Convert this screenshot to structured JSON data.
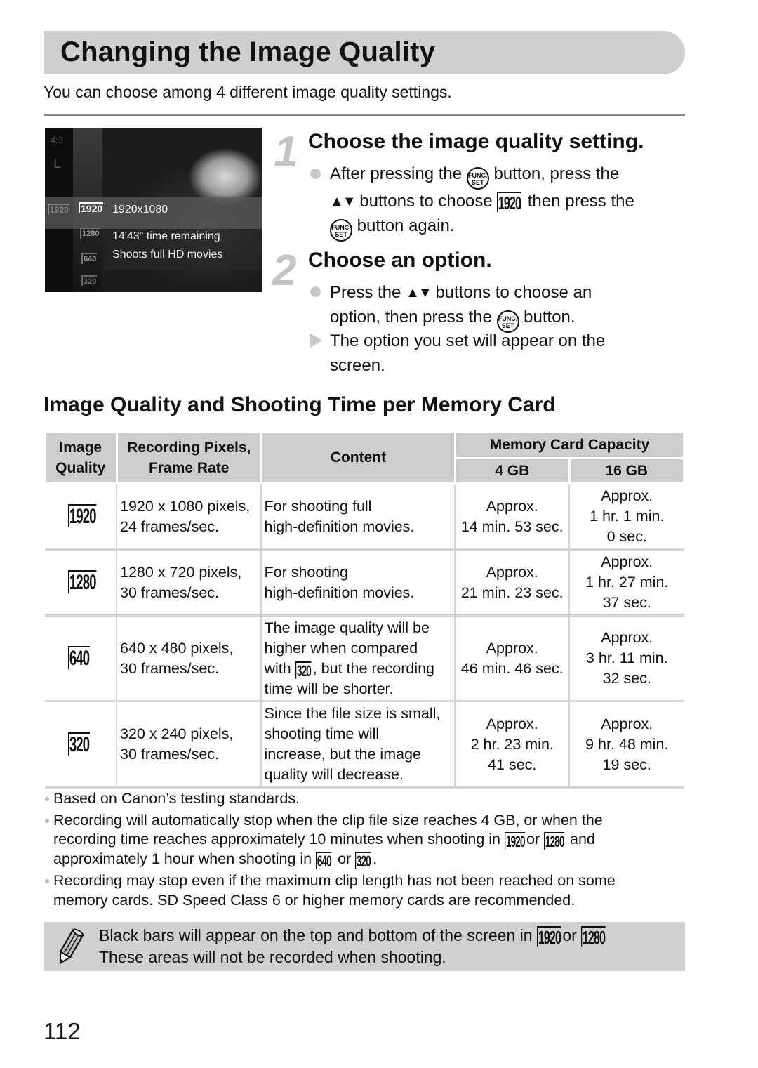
{
  "page": {
    "title": "Changing the Image Quality",
    "intro": "You can choose among 4 different image quality settings.",
    "page_number": "112"
  },
  "camera_screen": {
    "left_column_labels": [
      "4:3",
      "L"
    ],
    "selected_left_icon": "1920",
    "menu_icons": [
      "1920",
      "1280",
      "640",
      "320"
    ],
    "selected_option": "1920x1080",
    "time_remaining": "14'43\" time remaining",
    "description": "Shoots full HD movies"
  },
  "steps": [
    {
      "number": "1",
      "title": "Choose the image quality setting.",
      "bullet": {
        "p1": "After pressing the",
        "func_icon": "FUNC. SET",
        "p2": "button, press the",
        "arrows": "▲▼",
        "p3": "buttons to choose",
        "quality_icon": "1920",
        "p4": ", then press the",
        "p5": "button again."
      }
    },
    {
      "number": "2",
      "title": "Choose an option.",
      "bullet": {
        "p1": "Press the",
        "arrows": "▲▼",
        "p2": "buttons to choose an",
        "p3": "option, then press the",
        "p4": "button."
      },
      "result": {
        "line1": "The option you set will appear on the",
        "line2": "screen."
      }
    }
  ],
  "section": {
    "heading": "Image Quality and Shooting Time per Memory Card"
  },
  "table": {
    "headers": {
      "image_quality": [
        "Image",
        "Quality"
      ],
      "recording_pixels": [
        "Recording Pixels,",
        "Frame Rate"
      ],
      "content": "Content",
      "capacity": "Memory Card Capacity",
      "gb4": "4 GB",
      "gb16": "16 GB"
    },
    "rows": [
      {
        "icon": "1920",
        "pixels": [
          "1920 x 1080 pixels,",
          "24 frames/sec."
        ],
        "content": [
          "For shooting full",
          "high-definition movies."
        ],
        "gb4": [
          "Approx.",
          "14 min. 53 sec."
        ],
        "gb16": [
          "Approx.",
          "1 hr. 1 min.",
          "0 sec."
        ]
      },
      {
        "icon": "1280",
        "pixels": [
          "1280 x 720 pixels,",
          "30 frames/sec."
        ],
        "content": [
          "For shooting",
          "high-definition movies."
        ],
        "gb4": [
          "Approx.",
          "21 min. 23 sec."
        ],
        "gb16": [
          "Approx.",
          "1 hr. 27 min.",
          "37 sec."
        ]
      },
      {
        "icon": "640",
        "pixels": [
          "640 x 480 pixels,",
          "30 frames/sec."
        ],
        "content": [
          "The image quality will be",
          "higher when compared",
          "with",
          "320",
          ", but the recording",
          "time will be shorter."
        ],
        "gb4": [
          "Approx.",
          "46 min. 46 sec."
        ],
        "gb16": [
          "Approx.",
          "3 hr. 11 min.",
          "32 sec."
        ]
      },
      {
        "icon": "320",
        "pixels": [
          "320 x 240 pixels,",
          "30 frames/sec."
        ],
        "content": [
          "Since the file size is small,",
          "shooting time will",
          "increase, but the image",
          "quality will decrease."
        ],
        "gb4": [
          "Approx.",
          "2 hr. 23 min.",
          "41 sec."
        ],
        "gb16": [
          "Approx.",
          "9 hr. 48 min.",
          "19 sec."
        ]
      }
    ]
  },
  "notes": {
    "n1": "Based on Canon’s testing standards.",
    "n2_l1": "Recording will automatically stop when the clip file size reaches 4 GB, or when the",
    "n2_l2a": "recording time reaches approximately 10 minutes when shooting in",
    "n2_icon1": "1920",
    "n2_or1": "or",
    "n2_icon2": "1280",
    "n2_l2b": ", and",
    "n2_l3a": "approximately 1 hour when shooting in",
    "n2_icon3": "640",
    "n2_or2": "or",
    "n2_icon4": "320",
    "n2_l3b": ".",
    "n3_l1": "Recording may stop even if the maximum clip length has not been reached on some",
    "n3_l2": "memory cards. SD Speed Class 6 or higher memory cards are recommended."
  },
  "memo": {
    "l1a": "Black bars will appear on the top and bottom of the screen in",
    "icon1": "1920",
    "or": "or",
    "icon2": "1280",
    "l1b": ".",
    "l2": "These areas will not be recorded when shooting."
  },
  "colors": {
    "banner_gray": "#cfcfcf",
    "table_header_gray": "#cdcdcd",
    "step_number_gray": "#c4c4c4"
  }
}
